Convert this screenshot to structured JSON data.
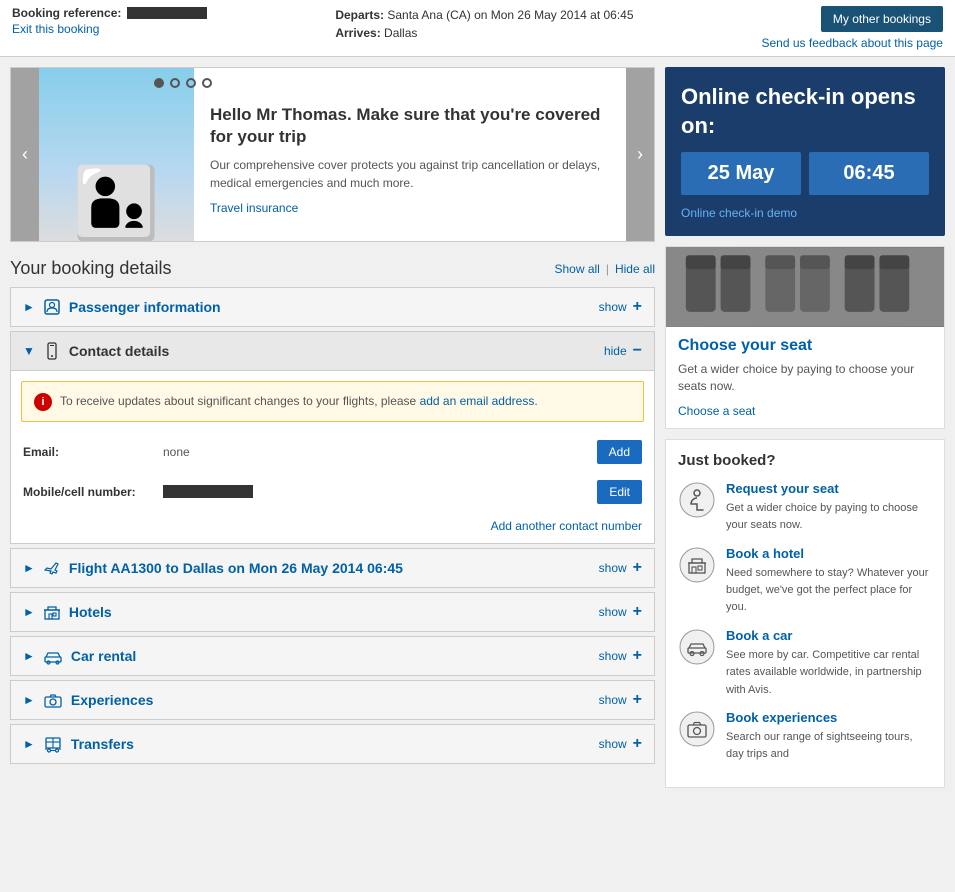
{
  "header": {
    "booking_ref_label": "Booking reference:",
    "departs_label": "Departs:",
    "departs_value": "Santa Ana (CA) on Mon 26 May 2014 at 06:45",
    "arrives_label": "Arrives:",
    "arrives_value": "Dallas",
    "exit_link": "Exit this booking",
    "my_other_bookings": "My other bookings",
    "feedback_link": "Send us feedback about this page"
  },
  "carousel": {
    "dots": [
      "dot1",
      "dot2",
      "dot3",
      "dot4"
    ],
    "active_dot": 1,
    "title": "Hello Mr Thomas. Make sure that you're covered for your trip",
    "description": "Our comprehensive cover protects you against trip cancellation or delays, medical emergencies and much more.",
    "link_text": "Travel insurance"
  },
  "booking_details": {
    "title": "Your booking details",
    "show_all": "Show all",
    "hide_all": "Hide all",
    "sections": [
      {
        "id": "passenger",
        "label": "Passenger information",
        "state": "collapsed",
        "icon": "person"
      },
      {
        "id": "contact",
        "label": "Contact details",
        "state": "expanded",
        "icon": "phone"
      },
      {
        "id": "flight",
        "label": "Flight AA1300 to Dallas on Mon 26 May 2014 06:45",
        "state": "collapsed",
        "icon": "plane"
      },
      {
        "id": "hotels",
        "label": "Hotels",
        "state": "collapsed",
        "icon": "hotel"
      },
      {
        "id": "carrental",
        "label": "Car rental",
        "state": "collapsed",
        "icon": "car"
      },
      {
        "id": "experiences",
        "label": "Experiences",
        "state": "collapsed",
        "icon": "camera"
      },
      {
        "id": "transfers",
        "label": "Transfers",
        "state": "collapsed",
        "icon": "bus"
      }
    ],
    "contact": {
      "alert_text": "To receive updates about significant changes to your flights, please",
      "alert_link": "add an email address.",
      "email_label": "Email:",
      "email_value": "none",
      "email_btn": "Add",
      "mobile_label": "Mobile/cell number:",
      "add_contact_link": "Add another contact number",
      "edit_btn": "Edit"
    }
  },
  "checkin": {
    "title": "Online check-in opens on:",
    "date": "25 May",
    "time": "06:45",
    "demo_link": "Online check-in demo"
  },
  "seat": {
    "title": "Choose your seat",
    "description": "Get a wider choice by paying to choose your seats now.",
    "link": "Choose a seat"
  },
  "just_booked": {
    "title": "Just booked?",
    "items": [
      {
        "id": "request-seat",
        "link": "Request your seat",
        "desc": "Get a wider choice by paying to choose your seats now."
      },
      {
        "id": "book-hotel",
        "link": "Book a hotel",
        "desc": "Need somewhere to stay? Whatever your budget, we've got the perfect place for you."
      },
      {
        "id": "book-car",
        "link": "Book a car",
        "desc": "See more by car. Competitive car rental rates available worldwide, in partnership with Avis."
      },
      {
        "id": "book-experiences",
        "link": "Book experiences",
        "desc": "Search our range of sightseeing tours, day trips and"
      }
    ]
  }
}
